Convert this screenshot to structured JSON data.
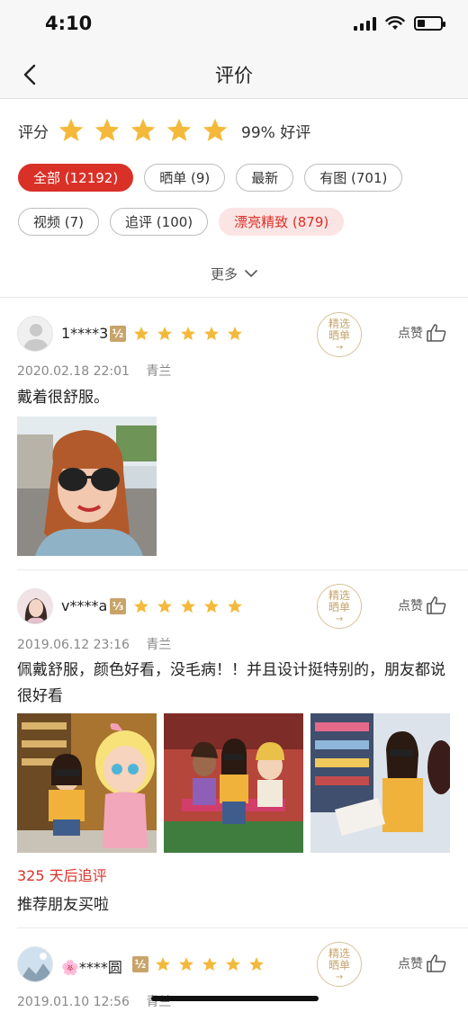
{
  "status": {
    "time": "4:10"
  },
  "nav": {
    "title": "评价"
  },
  "summary": {
    "label": "评分",
    "stars": 5,
    "rate": "99% 好评"
  },
  "filters": [
    {
      "label": "全部 (12192)",
      "state": "active"
    },
    {
      "label": "晒单 (9)",
      "state": "normal"
    },
    {
      "label": "最新",
      "state": "normal"
    },
    {
      "label": "有图 (701)",
      "state": "normal"
    },
    {
      "label": "视频 (7)",
      "state": "normal"
    },
    {
      "label": "追评 (100)",
      "state": "normal"
    },
    {
      "label": "漂亮精致 (879)",
      "state": "highlight"
    }
  ],
  "more_label": "更多",
  "colors": {
    "accent": "#d93128",
    "star": "#f4b93b",
    "level_badge": "#c8a46a"
  },
  "reviews": [
    {
      "user": "1****3",
      "level": "½",
      "stars": 5,
      "badge_line1": "精选",
      "badge_line2": "晒单",
      "like_label": "点赞",
      "date": "2020.02.18 22:01",
      "variant": "青兰",
      "text": "戴着很舒服。",
      "photos": 1
    },
    {
      "user": "v****a",
      "level": "⅓",
      "stars": 5,
      "badge_line1": "精选",
      "badge_line2": "晒单",
      "like_label": "点赞",
      "date": "2019.06.12 23:16",
      "variant": "青兰",
      "text": "佩戴舒服，颜色好看，没毛病！！并且设计挺特别的，朋友都说很好看",
      "photos": 3,
      "followup_label": "325 天后追评",
      "followup_text": "推荐朋友买啦"
    },
    {
      "user": "🌸****圆",
      "level": "½",
      "stars": 5,
      "badge_line1": "精选",
      "badge_line2": "晒单",
      "like_label": "点赞",
      "date": "2019.01.10 12:56",
      "variant": "青兰"
    }
  ]
}
